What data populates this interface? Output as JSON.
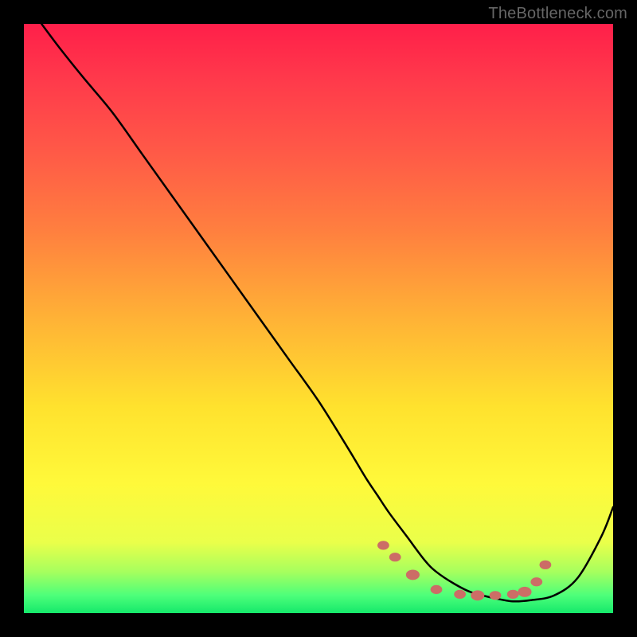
{
  "attribution": "TheBottleneck.com",
  "colors": {
    "bg_outer": "#000000",
    "gradient_stops": [
      {
        "offset": 0.0,
        "color": "#ff1f4a"
      },
      {
        "offset": 0.1,
        "color": "#ff3b4b"
      },
      {
        "offset": 0.22,
        "color": "#ff5a47"
      },
      {
        "offset": 0.35,
        "color": "#ff7f3f"
      },
      {
        "offset": 0.5,
        "color": "#ffb236"
      },
      {
        "offset": 0.65,
        "color": "#ffe22e"
      },
      {
        "offset": 0.78,
        "color": "#fff93a"
      },
      {
        "offset": 0.88,
        "color": "#eaff4a"
      },
      {
        "offset": 0.93,
        "color": "#a6ff5e"
      },
      {
        "offset": 0.97,
        "color": "#4dff7a"
      },
      {
        "offset": 1.0,
        "color": "#15e86b"
      }
    ],
    "curve": "#000000",
    "marker_fill": "#cc6d66",
    "marker_stroke": "#cc6d66"
  },
  "chart_data": {
    "type": "line",
    "title": "",
    "xlabel": "",
    "ylabel": "",
    "xlim": [
      0,
      100
    ],
    "ylim": [
      0,
      100
    ],
    "grid": false,
    "series": [
      {
        "name": "bottleneck-curve",
        "x": [
          3,
          6,
          10,
          15,
          20,
          25,
          30,
          35,
          40,
          45,
          50,
          55,
          58,
          60,
          62,
          65,
          68,
          70,
          73,
          76,
          80,
          83,
          86,
          90,
          94,
          98,
          100
        ],
        "y": [
          100,
          96,
          91,
          85,
          78,
          71,
          64,
          57,
          50,
          43,
          36,
          28,
          23,
          20,
          17,
          13,
          9,
          7,
          5,
          3.5,
          2.5,
          2,
          2.2,
          3,
          6,
          13,
          18
        ]
      }
    ],
    "markers": [
      {
        "x": 61,
        "y": 11.5
      },
      {
        "x": 63,
        "y": 9.5
      },
      {
        "x": 66,
        "y": 6.5
      },
      {
        "x": 70,
        "y": 4.0
      },
      {
        "x": 74,
        "y": 3.2
      },
      {
        "x": 77,
        "y": 3.0
      },
      {
        "x": 80,
        "y": 3.0
      },
      {
        "x": 83,
        "y": 3.2
      },
      {
        "x": 85,
        "y": 3.6
      },
      {
        "x": 87,
        "y": 5.3
      },
      {
        "x": 88.5,
        "y": 8.2
      }
    ],
    "marker_radii": [
      6,
      6,
      7,
      6,
      6,
      7,
      6,
      6,
      7,
      6,
      6
    ]
  }
}
